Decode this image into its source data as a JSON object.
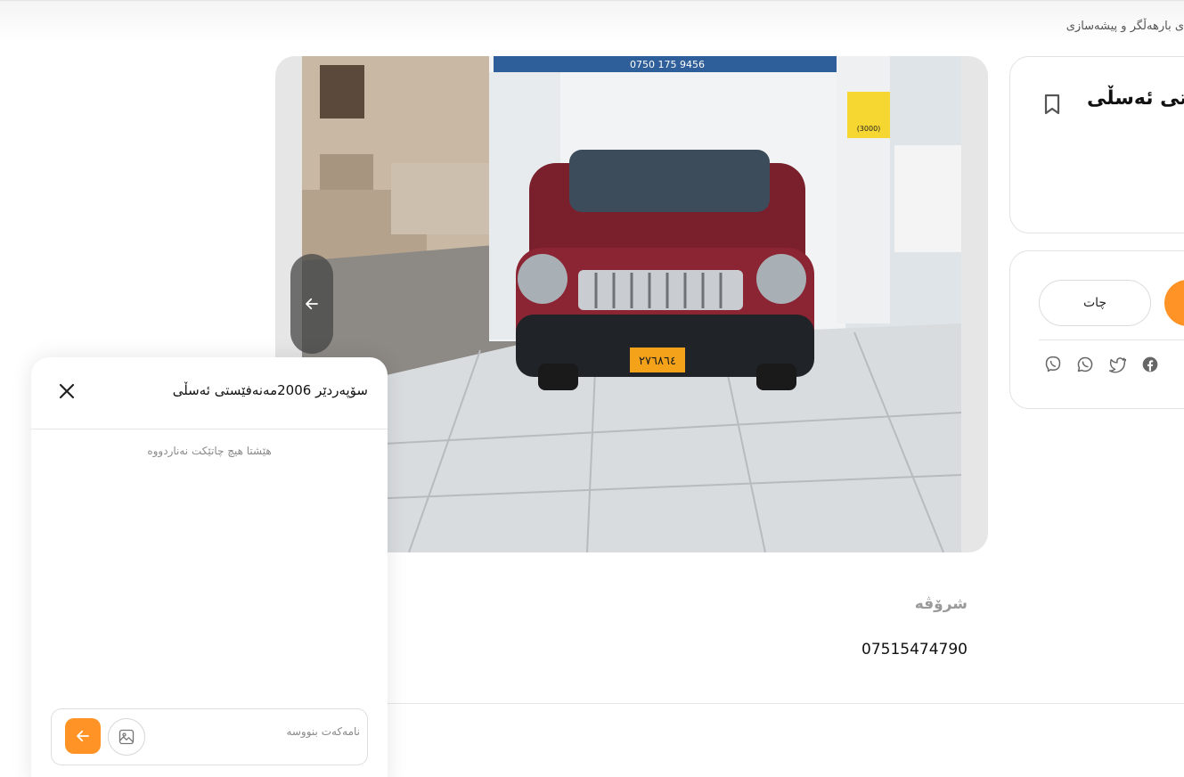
{
  "header": {
    "breadcrumb": "ی بارهەڵگر و پیشەسازی"
  },
  "listing": {
    "title": "ستی ئەسڵی",
    "photo_sign_phone": "0750 175 9456",
    "photo_plate": "٢٧٦٨٦٤",
    "photo_price_sign": "(3000)"
  },
  "contact": {
    "chat_label": "چات",
    "share_icons": [
      "viber-icon",
      "whatsapp-icon",
      "twitter-icon",
      "facebook-icon"
    ]
  },
  "details": {
    "label": "شرۆڤە",
    "value": "07515474790"
  },
  "chat_panel": {
    "title": "سۆپەردێر 2006مەنەفێستی ئەسڵی",
    "empty_text": "هێشتا هیچ چاتێکت نەناردووە",
    "input_placeholder": "نامەکەت بنووسە"
  },
  "colors": {
    "accent": "#ff9325",
    "border": "#e2e2e2",
    "muted_text": "#8a8a8a"
  }
}
